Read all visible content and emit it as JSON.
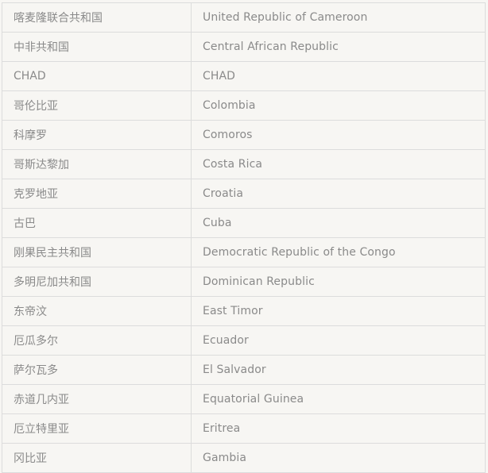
{
  "table": {
    "rows": [
      {
        "zh": "喀麦隆联合共和国",
        "en": "United Republic of  Cameroon"
      },
      {
        "zh": "中非共和国",
        "en": "Central African  Republic"
      },
      {
        "zh": "CHAD",
        "en": "CHAD"
      },
      {
        "zh": "哥伦比亚",
        "en": "Colombia"
      },
      {
        "zh": "科摩罗",
        "en": "Comoros"
      },
      {
        "zh": "哥斯达黎加",
        "en": "Costa Rica"
      },
      {
        "zh": "克罗地亚",
        "en": "Croatia"
      },
      {
        "zh": "古巴",
        "en": "Cuba"
      },
      {
        "zh": "刚果民主共和国",
        "en": "Democratic Republic of  the Congo"
      },
      {
        "zh": "多明尼加共和国",
        "en": "Dominican Republic"
      },
      {
        "zh": "东帝汶",
        "en": "East Timor"
      },
      {
        "zh": "厄瓜多尔",
        "en": "Ecuador"
      },
      {
        "zh": "萨尔瓦多",
        "en": "El Salvador"
      },
      {
        "zh": "赤道几内亚",
        "en": "Equatorial Guinea"
      },
      {
        "zh": "厄立特里亚",
        "en": "Eritrea"
      },
      {
        "zh": "冈比亚",
        "en": "Gambia"
      }
    ]
  }
}
